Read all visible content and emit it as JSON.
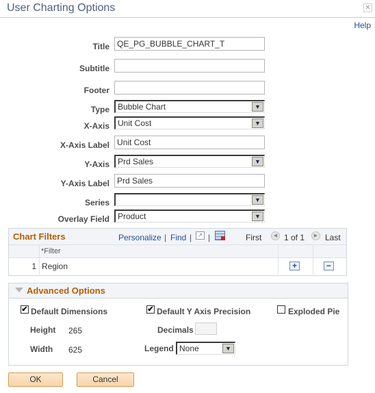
{
  "window": {
    "title": "User Charting Options",
    "close_icon": "close-icon",
    "help_label": "Help"
  },
  "form": {
    "title": {
      "label": "Title",
      "value": "QE_PG_BUBBLE_CHART_T"
    },
    "subtitle": {
      "label": "Subtitle",
      "value": ""
    },
    "footer": {
      "label": "Footer",
      "value": ""
    },
    "type": {
      "label": "Type",
      "value": "Bubble Chart"
    },
    "x_axis": {
      "label": "X-Axis",
      "value": "Unit Cost"
    },
    "x_axis_label": {
      "label": "X-Axis Label",
      "value": "Unit Cost"
    },
    "y_axis": {
      "label": "Y-Axis",
      "value": "Prd Sales"
    },
    "y_axis_label": {
      "label": "Y-Axis Label",
      "value": "Prd Sales"
    },
    "series": {
      "label": "Series",
      "value": ""
    },
    "overlay_field": {
      "label": "Overlay Field",
      "value": "Product"
    }
  },
  "chart_filters": {
    "title": "Chart Filters",
    "personalize": "Personalize",
    "find": "Find",
    "sep": "|",
    "first": "First",
    "page": "1 of 1",
    "last": "Last",
    "column_header": "*Filter",
    "rows": [
      {
        "num": "1",
        "filter": "Region"
      }
    ],
    "add_symbol": "+",
    "remove_symbol": "−"
  },
  "advanced": {
    "title": "Advanced Options",
    "default_dimensions": {
      "label": "Default Dimensions",
      "checked": true
    },
    "default_y_precision": {
      "label": "Default Y Axis Precision",
      "checked": true
    },
    "exploded_pie": {
      "label": "Exploded Pie",
      "checked": false
    },
    "height": {
      "label": "Height",
      "value": "265"
    },
    "width": {
      "label": "Width",
      "value": "625"
    },
    "decimals": {
      "label": "Decimals",
      "value": ""
    },
    "legend": {
      "label": "Legend",
      "value": "None"
    }
  },
  "buttons": {
    "ok": "OK",
    "cancel": "Cancel"
  },
  "icons": {
    "check": "✔",
    "chevron": "⌄",
    "prev": "◀",
    "next": "▶"
  }
}
